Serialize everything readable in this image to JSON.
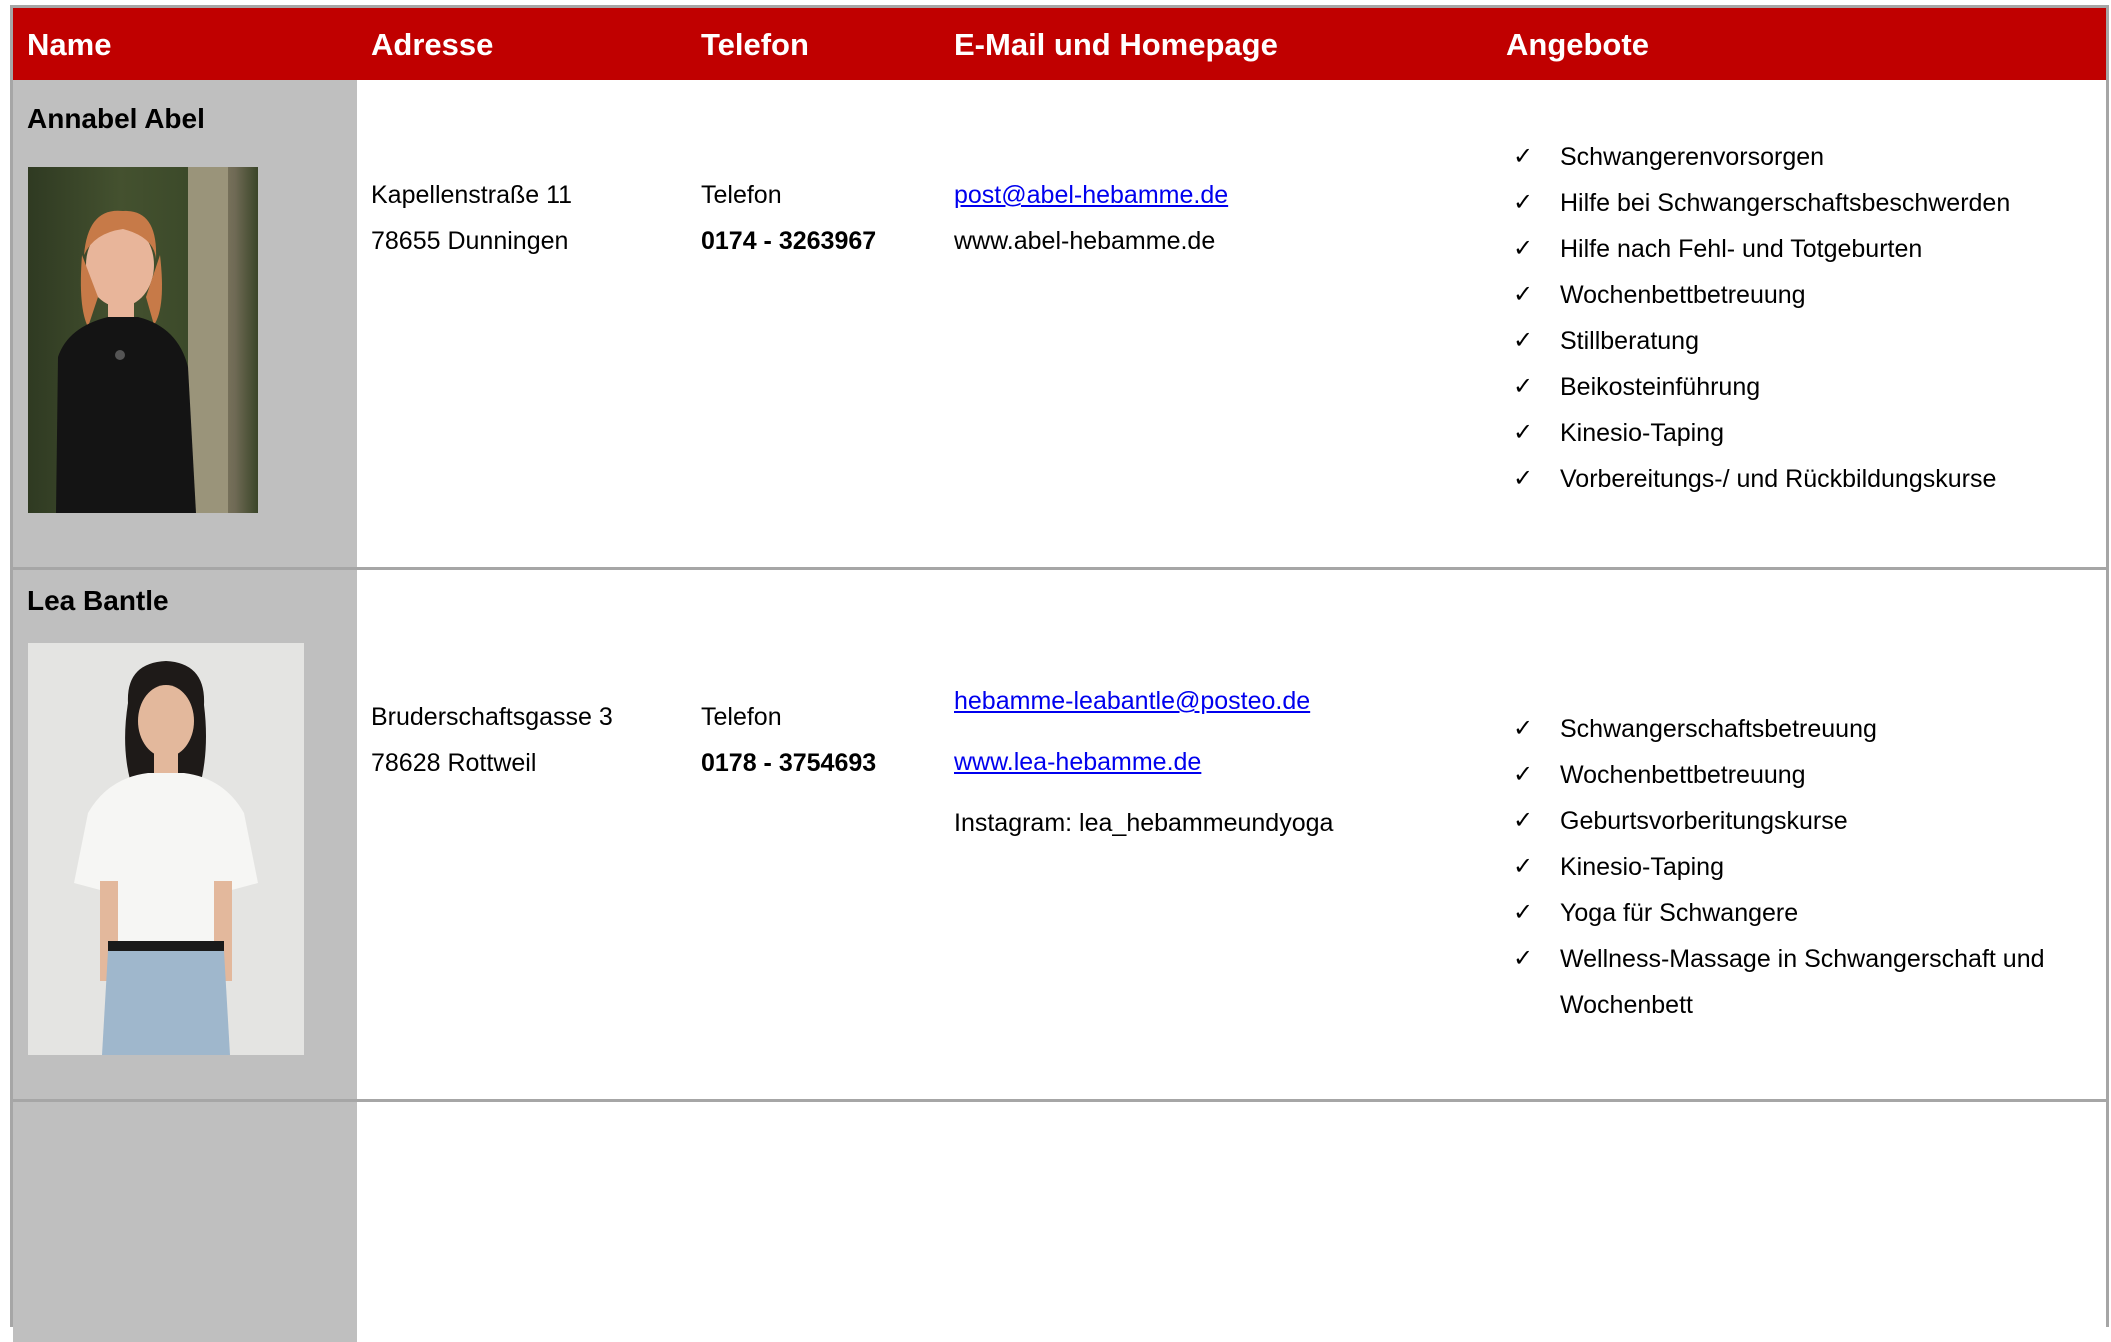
{
  "header": {
    "name": "Name",
    "address": "Adresse",
    "phone": "Telefon",
    "email": "E-Mail und Homepage",
    "offers": "Angebote"
  },
  "check_glyph": "✓",
  "rows": [
    {
      "name": "Annabel Abel",
      "photo": "portrait-photo",
      "address_line1": "Kapellenstraße 11",
      "address_line2": "78655 Dunningen",
      "phone_label": "Telefon",
      "phone_number": "0174 - 3263967",
      "email": "post@abel-hebamme.de",
      "homepage": "www.abel-hebamme.de",
      "offers": [
        "Schwangerenvorsorgen",
        "Hilfe bei Schwangerschaftsbeschwerden",
        "Hilfe nach Fehl- und Totgeburten",
        "Wochenbettbetreuung",
        "Stillberatung",
        "Beikosteinführung",
        "Kinesio-Taping",
        "Vorbereitungs-/ und Rückbildungskurse"
      ]
    },
    {
      "name": "Lea Bantle",
      "photo": "portrait-photo",
      "address_line1": "Bruderschaftsgasse 3",
      "address_line2": "78628 Rottweil",
      "phone_label": "Telefon",
      "phone_number": "0178 - 3754693",
      "email": "hebamme-leabantle@posteo.de",
      "homepage": "www.lea-hebamme.de",
      "instagram": "Instagram: lea_hebammeundyoga",
      "offers": [
        "Schwangerschaftsbetreuung",
        "Wochenbettbetreuung",
        "Geburtsvorberitungskurse",
        "Kinesio-Taping",
        "Yoga für Schwangere",
        "Wellness-Massage in Schwangerschaft und Wochenbett"
      ]
    }
  ],
  "colors": {
    "header_bg": "#c00000",
    "name_column_bg": "#bfbfbf",
    "border": "#a6a6a6",
    "link": "#0000ee"
  }
}
